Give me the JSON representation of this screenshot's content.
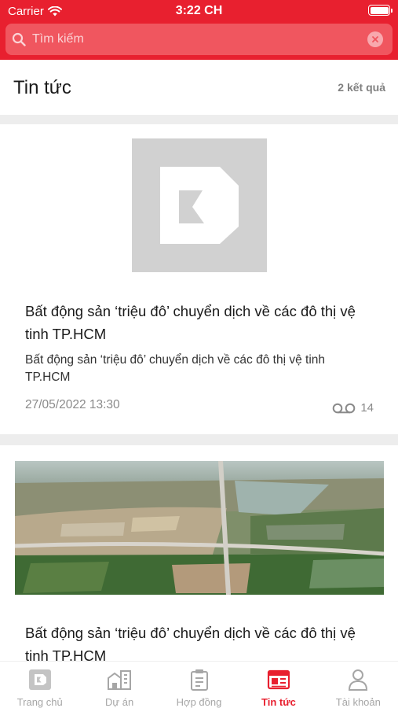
{
  "status_bar": {
    "carrier": "Carrier",
    "time": "3:22 CH"
  },
  "search": {
    "placeholder": "Tìm kiếm",
    "value": ""
  },
  "section": {
    "title": "Tin tức",
    "result_count": "2 kết quả"
  },
  "articles": [
    {
      "title": "Bất động sản ‘triệu đô’ chuyển dịch về các đô thị vệ tinh TP.HCM",
      "summary": "Bất động sản ‘triệu đô’ chuyển dịch về các đô thị vệ tinh TP.HCM",
      "date": "27/05/2022 13:30",
      "views": "14",
      "thumbnail": "placeholder-logo"
    },
    {
      "title": "Bất động sản ‘triệu đô’ chuyển dịch về các đô thị vệ tinh TP.HCM",
      "thumbnail": "aerial-city-photo"
    }
  ],
  "tabs": [
    {
      "label": "Trang chủ",
      "icon": "home-logo-icon",
      "active": false
    },
    {
      "label": "Dự án",
      "icon": "buildings-icon",
      "active": false
    },
    {
      "label": "Hợp đồng",
      "icon": "clipboard-icon",
      "active": false
    },
    {
      "label": "Tin tức",
      "icon": "newspaper-icon",
      "active": true
    },
    {
      "label": "Tài khoản",
      "icon": "user-icon",
      "active": false
    }
  ],
  "colors": {
    "brand": "#e8202f",
    "muted": "#a6a6a6"
  }
}
